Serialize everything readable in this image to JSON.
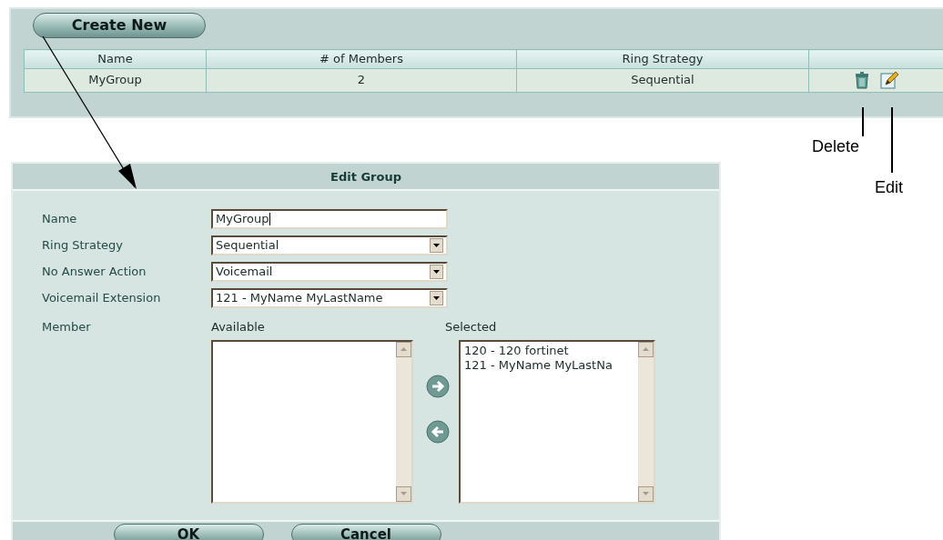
{
  "create_button": "Create New",
  "table": {
    "columns": [
      "Name",
      "# of Members",
      "Ring Strategy"
    ],
    "rows": [
      {
        "cells": [
          "MyGroup",
          "2",
          "Sequential"
        ]
      }
    ]
  },
  "callouts": [
    "Delete",
    "Edit"
  ],
  "dialog": {
    "title": "Edit Group",
    "fields": [
      {
        "label": "Name",
        "kind": "text",
        "value": "MyGroup"
      },
      {
        "label": "Ring Strategy",
        "kind": "select",
        "value": "Sequential"
      },
      {
        "label": "No Answer Action",
        "kind": "select",
        "value": "Voicemail"
      },
      {
        "label": "Voicemail Extension",
        "kind": "select",
        "value": "121 - MyName MyLastName"
      }
    ],
    "member_label": "Member",
    "available_label": "Available",
    "selected_label": "Selected",
    "selected_items": [
      "120 - 120 fortinet",
      "121 - MyName MyLastNa"
    ],
    "buttons": [
      "OK",
      "Cancel"
    ]
  }
}
